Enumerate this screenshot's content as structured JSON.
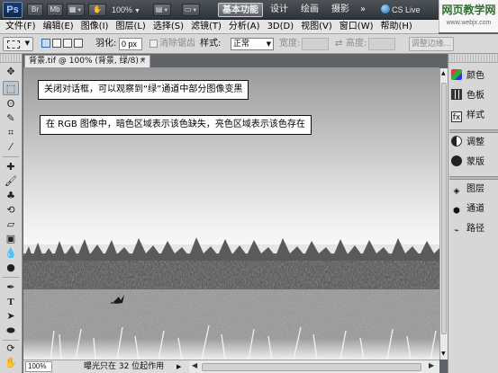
{
  "app": {
    "logo": "Ps",
    "toolbar_buttons": [
      "Br",
      "Mb"
    ],
    "zoom": "100%",
    "workspaces": [
      "基本功能",
      "设计",
      "绘画",
      "摄影"
    ],
    "more": "»",
    "cs_live": "CS Live",
    "watermark_title": "网页教学网",
    "watermark_url": "www.webjx.com"
  },
  "menu": {
    "items": [
      "文件(F)",
      "编辑(E)",
      "图像(I)",
      "图层(L)",
      "选择(S)",
      "滤镜(T)",
      "分析(A)",
      "3D(D)",
      "视图(V)",
      "窗口(W)",
      "帮助(H)"
    ]
  },
  "options": {
    "feather_label": "羽化:",
    "feather_value": "0 px",
    "antialias_label": "消除锯齿",
    "style_label": "样式:",
    "style_value": "正常",
    "width_label": "宽度:",
    "height_label": "高度:",
    "refine_edge_label": "调整边缘..."
  },
  "tools": {
    "items": [
      "move-icon",
      "marquee-icon",
      "lasso-icon",
      "quick-select-icon",
      "crop-icon",
      "eyedropper-icon",
      "healing-brush-icon",
      "brush-icon",
      "clone-stamp-icon",
      "history-brush-icon",
      "eraser-icon",
      "gradient-icon",
      "blur-icon",
      "dodge-icon",
      "pen-icon",
      "type-icon",
      "path-select-icon",
      "shape-icon",
      "3d-rotate-icon",
      "hand-icon"
    ]
  },
  "document": {
    "tab_title": "背景.tif @ 100% (背景, 绿/8) *",
    "close": "×",
    "zoom": "100%",
    "status_info": "曝光只在 32 位起作用",
    "callout_1": "关闭对话框，可以观察到“绿”通道中部分图像变黑",
    "callout_2": "在 RGB 图像中，暗色区域表示该色缺失，亮色区域表示该色存在"
  },
  "panels": {
    "group1": [
      {
        "icon": "color-icon",
        "label": "颜色"
      },
      {
        "icon": "swatches-icon",
        "label": "色板"
      },
      {
        "icon": "styles-icon",
        "label": "样式"
      }
    ],
    "group2": [
      {
        "icon": "adjustments-icon",
        "label": "调整"
      },
      {
        "icon": "masks-icon",
        "label": "蒙版"
      }
    ],
    "group3": [
      {
        "icon": "layers-icon",
        "label": "图层"
      },
      {
        "icon": "channels-icon",
        "label": "通道"
      },
      {
        "icon": "paths-icon",
        "label": "路径"
      }
    ]
  },
  "colors": {
    "appbar": "#3a3f44",
    "panel_bg": "#d7d7d7",
    "active_workspace": "#6c7277"
  }
}
